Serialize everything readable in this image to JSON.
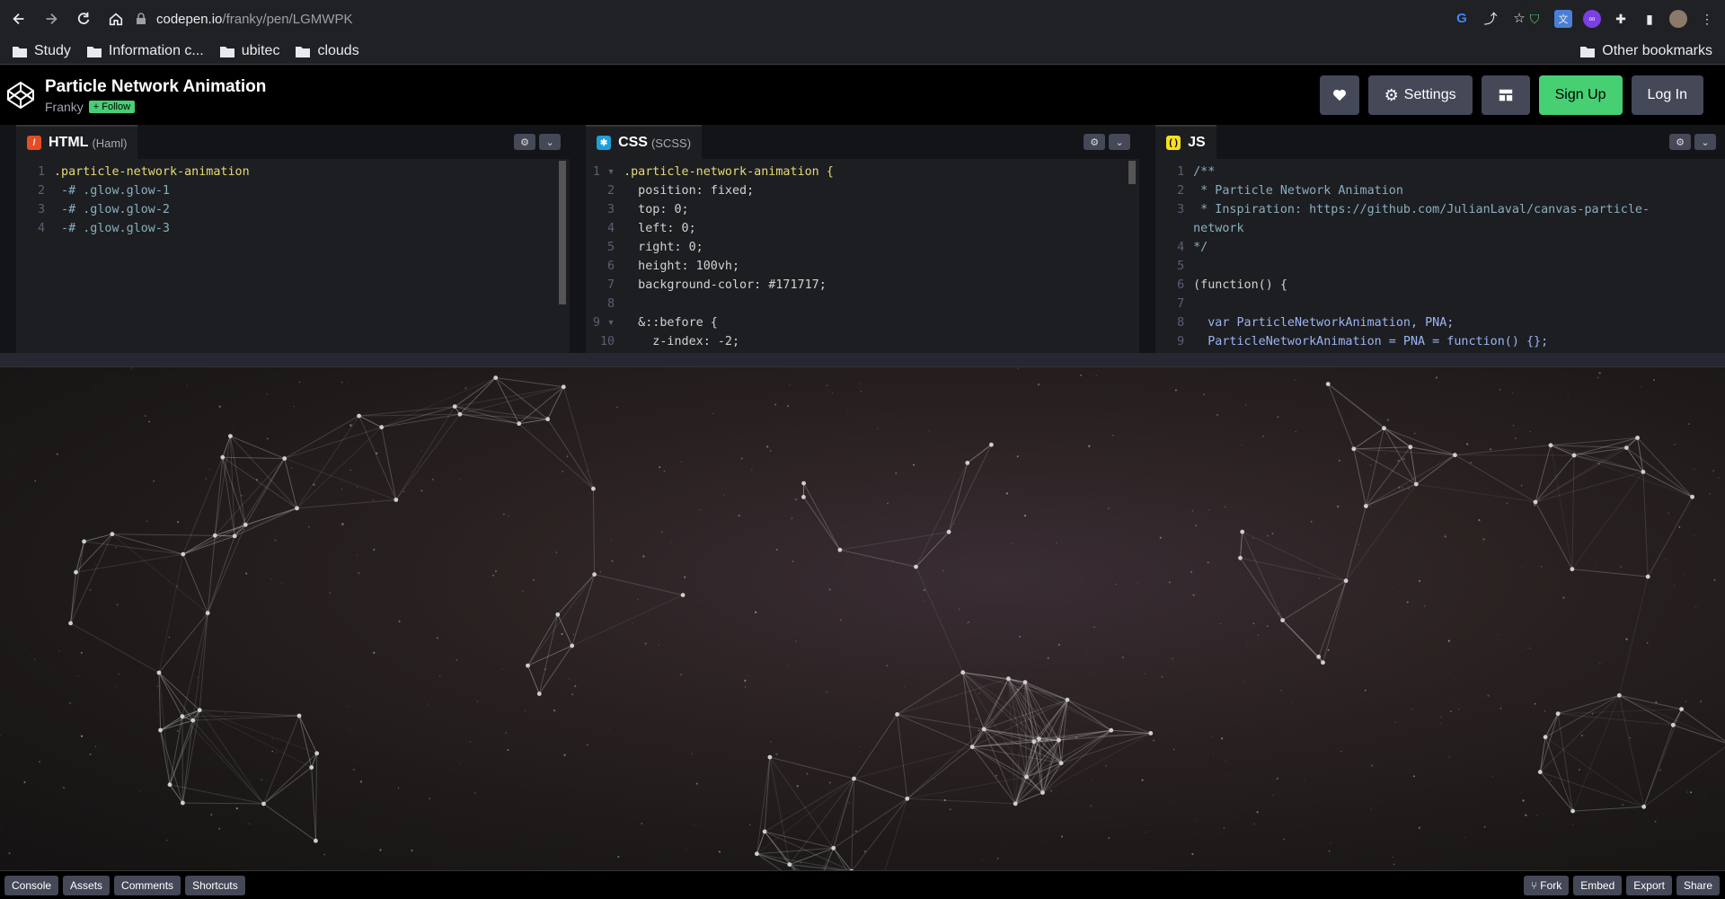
{
  "browser": {
    "url_domain": "codepen.io",
    "url_path": "/franky/pen/LGMWPK",
    "bookmarks": [
      "Study",
      "Information c...",
      "ubitec",
      "clouds"
    ],
    "other_bookmarks": "Other bookmarks"
  },
  "header": {
    "title": "Particle Network Animation",
    "author": "Franky",
    "follow_label": "+ Follow",
    "settings_label": "Settings",
    "signup_label": "Sign Up",
    "login_label": "Log In"
  },
  "editors": {
    "html": {
      "title": "HTML",
      "subtitle": "(Haml)",
      "lines": [
        ".particle-network-animation",
        " -# .glow.glow-1",
        " -# .glow.glow-2",
        " -# .glow.glow-3"
      ]
    },
    "css": {
      "title": "CSS",
      "subtitle": "(SCSS)",
      "lines": [
        ".particle-network-animation {",
        "  position: fixed;",
        "  top: 0;",
        "  left: 0;",
        "  right: 0;",
        "  height: 100vh;",
        "  background-color: #171717;",
        "",
        "  &::before {",
        "    z-index: -2;"
      ]
    },
    "js": {
      "title": "JS",
      "subtitle": "",
      "lines": [
        "/**",
        " * Particle Network Animation",
        " * Inspiration: https://github.com/JulianLaval/canvas-particle-",
        "network",
        "*/",
        "",
        "(function() {",
        "",
        "  var ParticleNetworkAnimation, PNA;",
        "  ParticleNetworkAnimation = PNA = function() {};"
      ],
      "line_numbers": [
        "1",
        "2",
        "3",
        "",
        "4",
        "5",
        "6",
        "7",
        "8",
        "9"
      ]
    }
  },
  "footer": {
    "left": [
      "Console",
      "Assets",
      "Comments",
      "Shortcuts"
    ],
    "right": [
      "Fork",
      "Embed",
      "Export",
      "Share"
    ]
  },
  "colors": {
    "accent_green": "#47cf73",
    "button_gray": "#444857",
    "html_icon": "#e44d26",
    "css_icon": "#1f9fd8",
    "js_icon": "#f7df1e"
  }
}
